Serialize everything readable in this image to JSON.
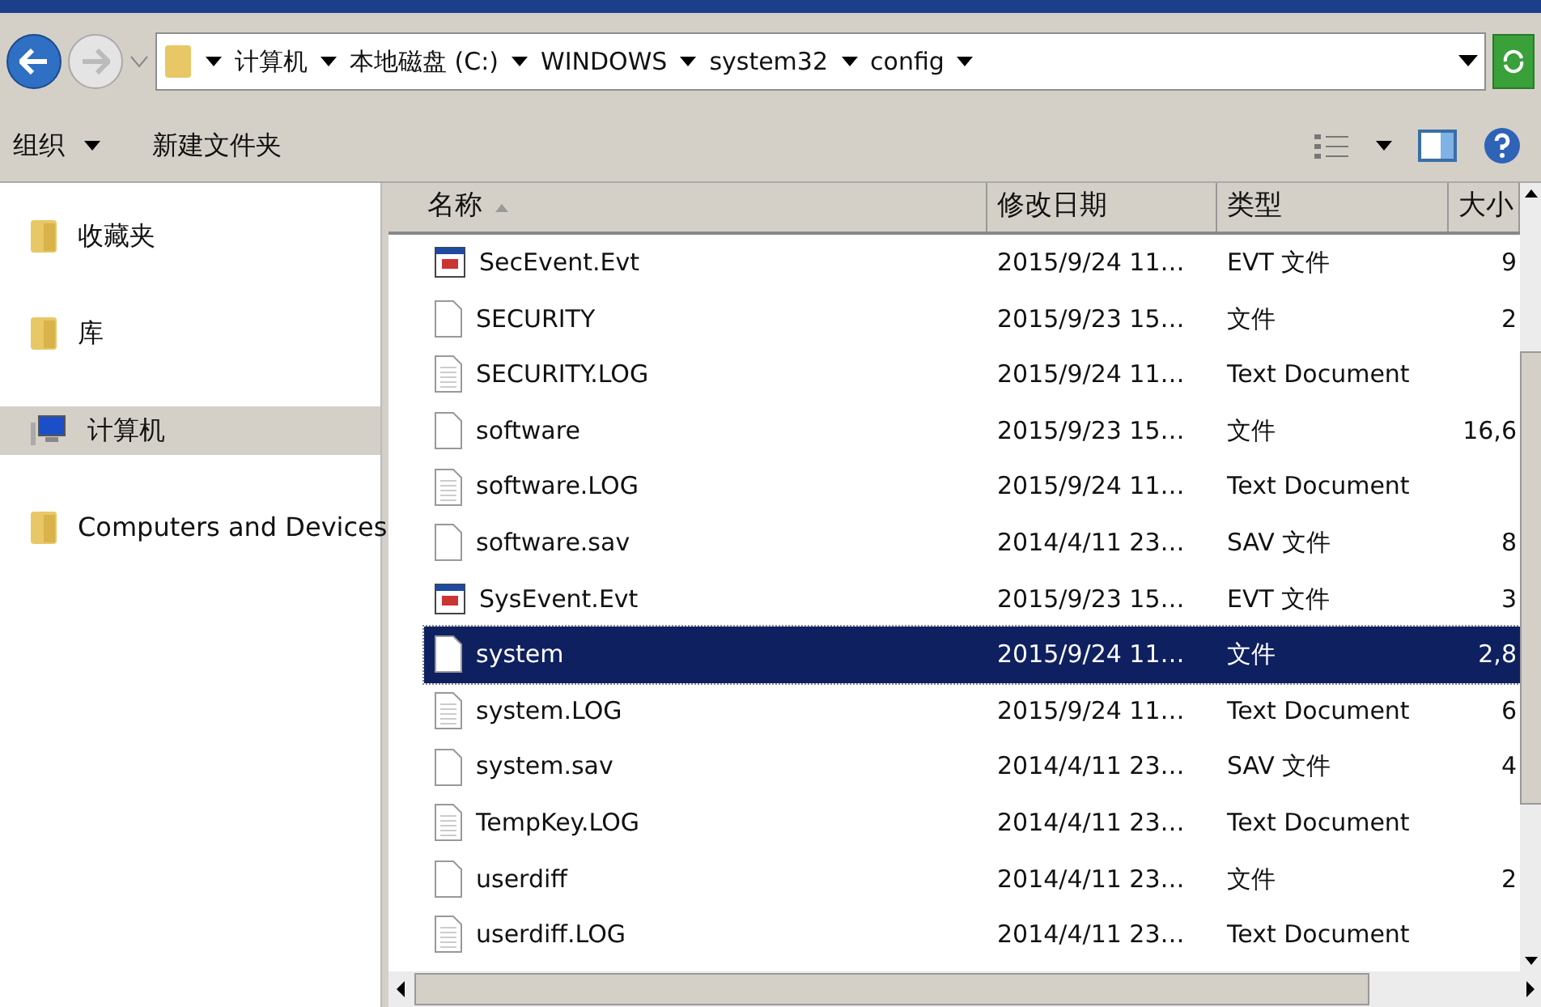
{
  "address_bar": {
    "crumbs": [
      "计算机",
      "本地磁盘 (C:)",
      "WINDOWS",
      "system32",
      "config"
    ]
  },
  "toolbar": {
    "items": [
      "组织",
      "新建文件夹"
    ]
  },
  "sidebar": {
    "items": [
      {
        "label": "收藏夹",
        "kind": "folder",
        "selected": false
      },
      {
        "label": "库",
        "kind": "folder",
        "selected": false
      },
      {
        "label": "计算机",
        "kind": "computer",
        "selected": true
      },
      {
        "label": "Computers and Devices",
        "kind": "folder",
        "selected": false
      }
    ]
  },
  "table": {
    "columns": [
      "名称",
      "修改日期",
      "类型",
      "大小"
    ],
    "rows": [
      {
        "name": "SecEvent.Evt",
        "kind": "evt",
        "date": "2015/9/24 11…",
        "type": "EVT 文件",
        "size": "9",
        "selected": false
      },
      {
        "name": "SECURITY",
        "kind": "file",
        "date": "2015/9/23 15…",
        "type": "文件",
        "size": "2",
        "selected": false
      },
      {
        "name": "SECURITY.LOG",
        "kind": "text",
        "date": "2015/9/24 11…",
        "type": "Text Document",
        "selected": false
      },
      {
        "name": "software",
        "kind": "file",
        "date": "2015/9/23 15…",
        "type": "文件",
        "size": "16,6",
        "selected": false
      },
      {
        "name": "software.LOG",
        "kind": "text",
        "date": "2015/9/24 11…",
        "type": "Text Document",
        "selected": false
      },
      {
        "name": "software.sav",
        "kind": "file",
        "date": "2014/4/11 23…",
        "type": "SAV 文件",
        "size": "8",
        "selected": false
      },
      {
        "name": "SysEvent.Evt",
        "kind": "evt",
        "date": "2015/9/23 15…",
        "type": "EVT 文件",
        "size": "3",
        "selected": false
      },
      {
        "name": "system",
        "kind": "file",
        "date": "2015/9/24 11…",
        "type": "文件",
        "size": "2,8",
        "selected": true
      },
      {
        "name": "system.LOG",
        "kind": "text",
        "date": "2015/9/24 11…",
        "type": "Text Document",
        "size": "6",
        "selected": false
      },
      {
        "name": "system.sav",
        "kind": "file",
        "date": "2014/4/11 23…",
        "type": "SAV 文件",
        "size": "4",
        "selected": false
      },
      {
        "name": "TempKey.LOG",
        "kind": "text",
        "date": "2014/4/11 23…",
        "type": "Text Document",
        "selected": false
      },
      {
        "name": "userdiff",
        "kind": "file",
        "date": "2014/4/11 23…",
        "type": "文件",
        "size": "2",
        "selected": false
      },
      {
        "name": "userdiff.LOG",
        "kind": "text",
        "date": "2014/4/11 23…",
        "type": "Text Document",
        "selected": false
      }
    ]
  }
}
